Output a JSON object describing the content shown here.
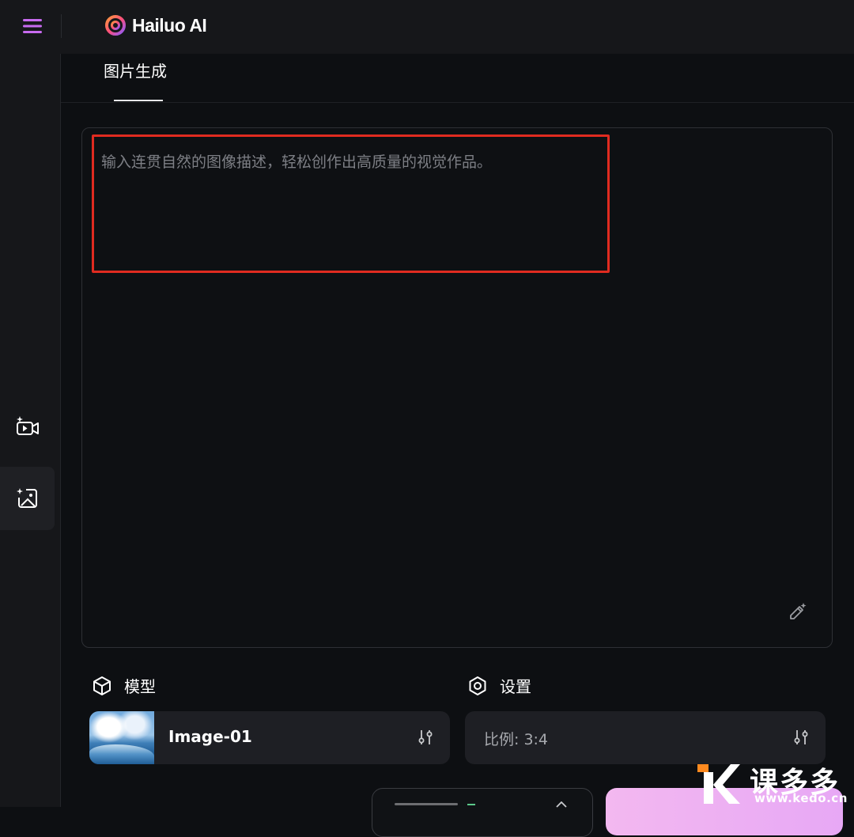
{
  "header": {
    "logo_text": "Hailuo AI",
    "icons": [
      "menu-icon",
      "hailuo-logo"
    ]
  },
  "sidebar": {
    "items": [
      {
        "icon": "video-generate-icon",
        "active": false
      },
      {
        "icon": "image-generate-icon",
        "active": true
      }
    ]
  },
  "tabs": [
    {
      "label": "图片生成",
      "active": true
    }
  ],
  "prompt": {
    "value": "",
    "placeholder": "输入连贯自然的图像描述，轻松创作出高质量的视觉作品。"
  },
  "model_section": {
    "label": "模型",
    "selected_model": "Image-01"
  },
  "settings_section": {
    "label": "设置",
    "ratio_text": "比例: 3:4"
  },
  "watermark": {
    "text": "课多多",
    "url": "www.kedo.cn"
  },
  "colors": {
    "background": "#0d0f12",
    "panel": "#16171a",
    "card": "#1e1f24",
    "accent_menu": "#c86bf0",
    "highlight_border": "#e02b20",
    "generate_gradient": "#f3b8f0"
  }
}
